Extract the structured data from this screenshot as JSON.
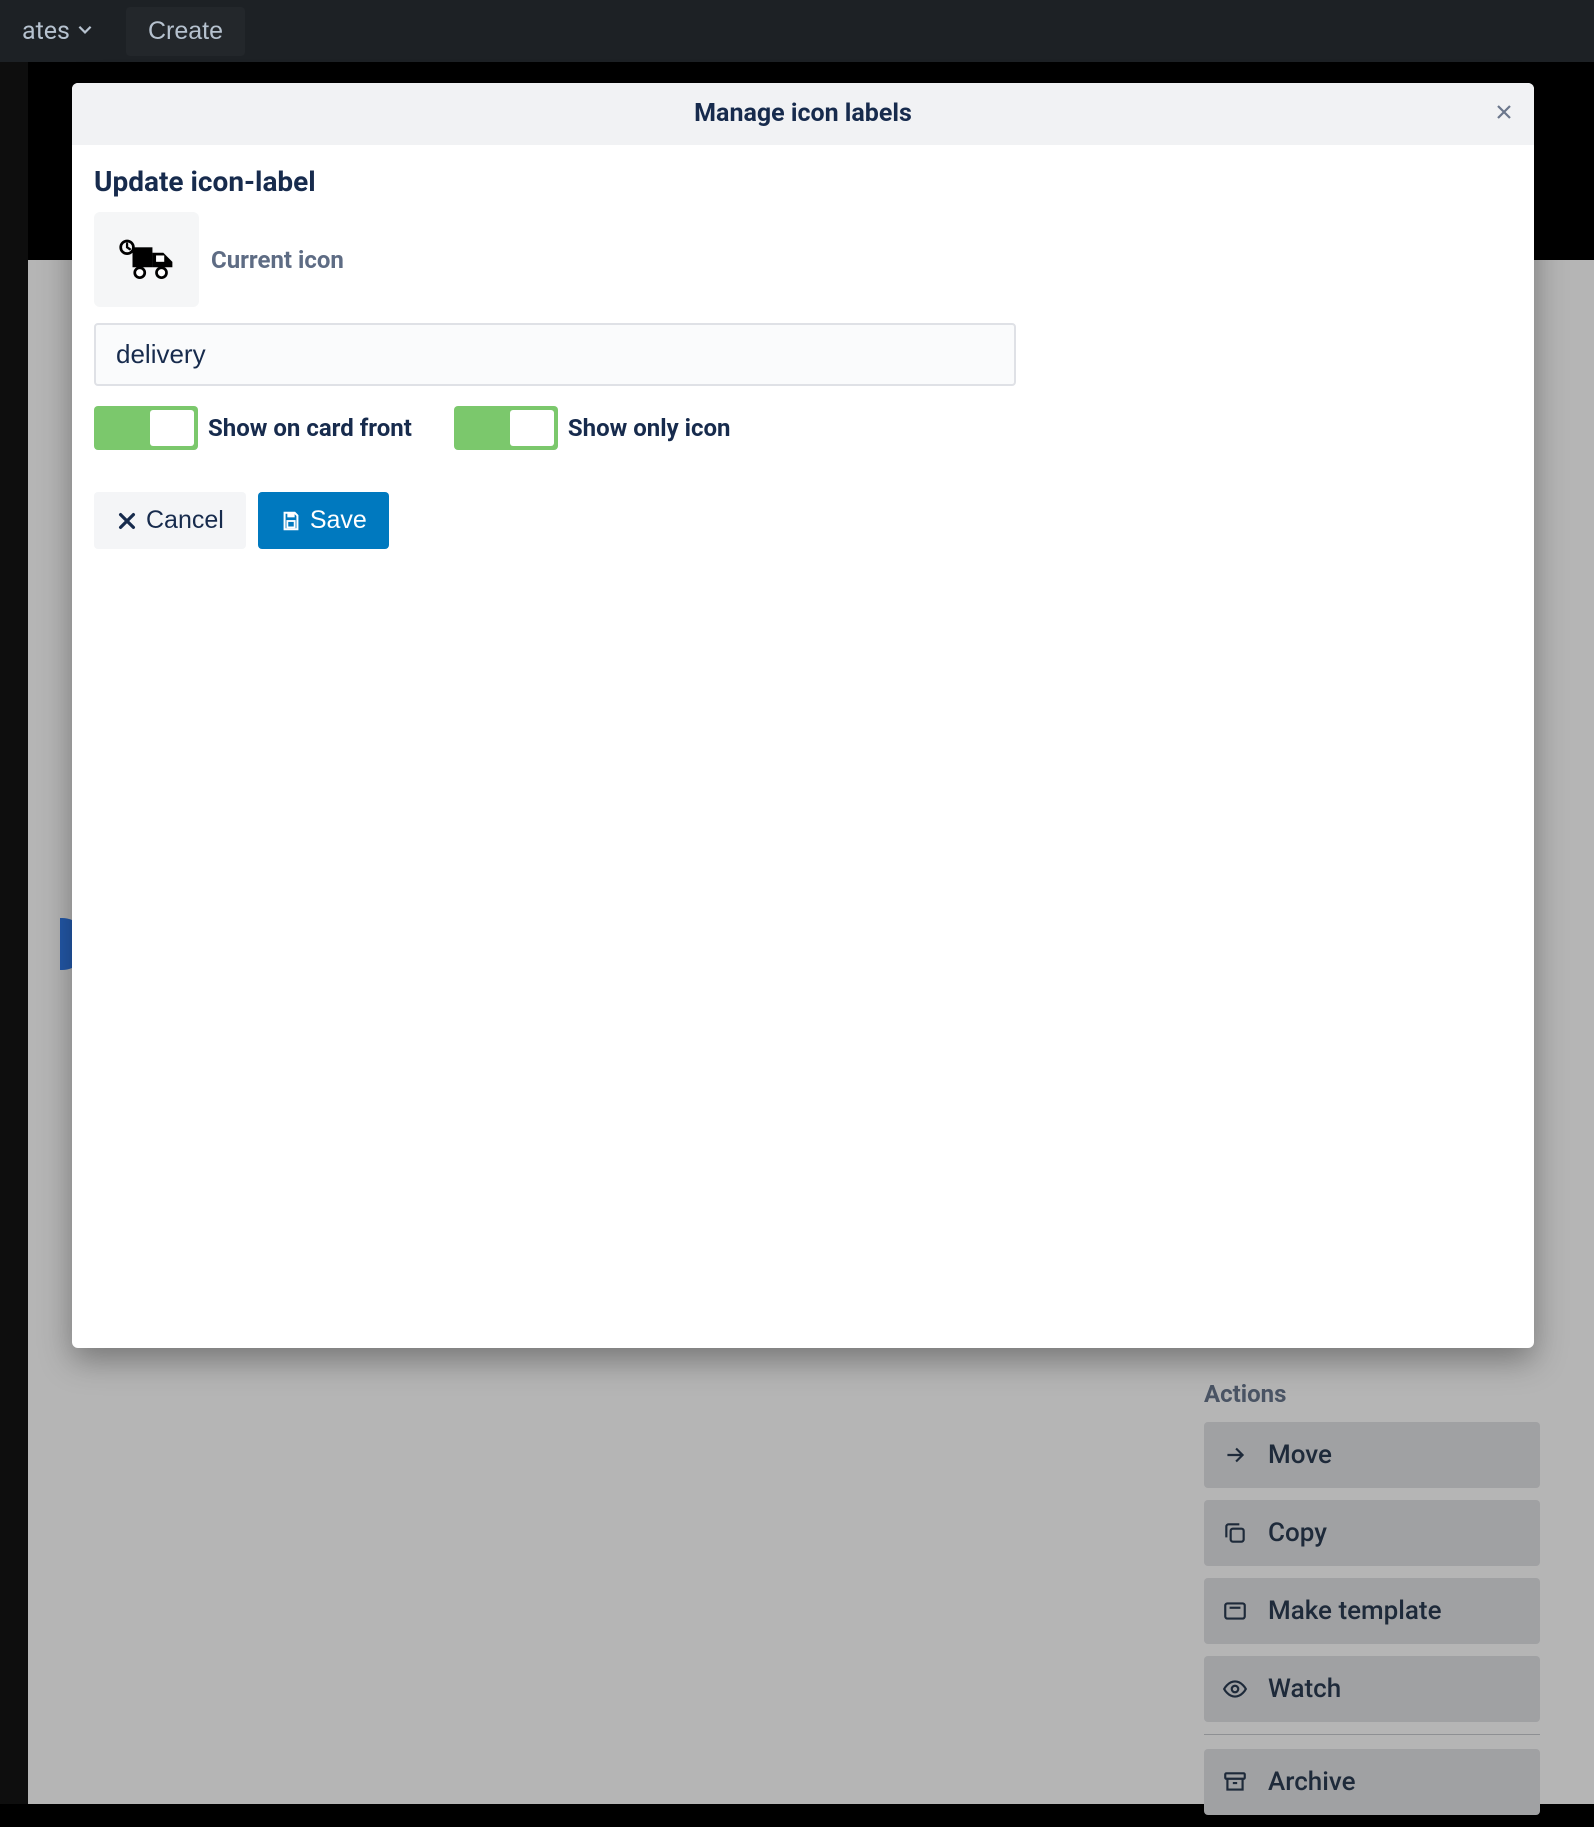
{
  "nav": {
    "item_partial": "ates",
    "create": "Create"
  },
  "modal": {
    "header_title": "Manage icon labels",
    "section_title": "Update icon-label",
    "current_icon_label": "Current icon",
    "input_value": "delivery",
    "toggle1_label": "Show on card front",
    "toggle2_label": "Show only icon",
    "cancel": "Cancel",
    "save": "Save"
  },
  "actions": {
    "heading": "Actions",
    "move": "Move",
    "copy": "Copy",
    "make_template": "Make template",
    "watch": "Watch",
    "archive": "Archive"
  }
}
